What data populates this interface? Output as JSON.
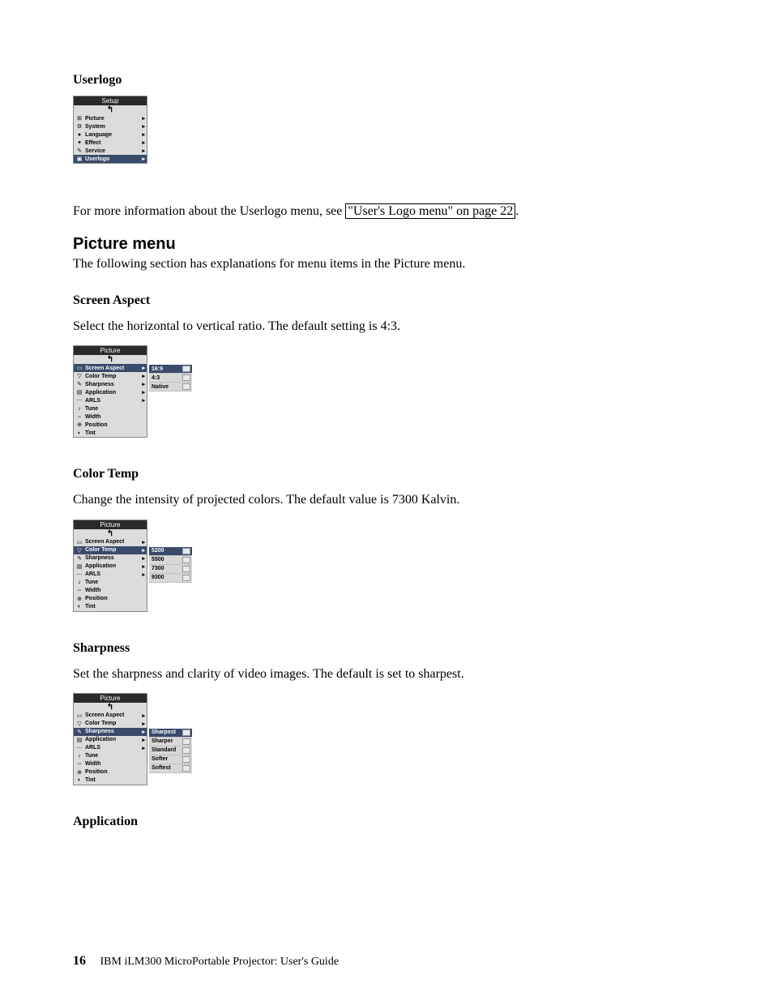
{
  "userlogo": {
    "heading": "Userlogo",
    "menu_title": "Setup",
    "items": [
      {
        "label": "Picture",
        "arrow": true,
        "icon": "⊞"
      },
      {
        "label": "System",
        "arrow": true,
        "icon": "⚙"
      },
      {
        "label": "Language",
        "arrow": true,
        "icon": "●"
      },
      {
        "label": "Effect",
        "arrow": true,
        "icon": "✦"
      },
      {
        "label": "Service",
        "arrow": true,
        "icon": "✎"
      },
      {
        "label": "Userlogo",
        "arrow": true,
        "icon": "▣",
        "selected": true
      }
    ],
    "para": "For more information about the Userlogo menu, see ",
    "link_text": "\"User's Logo menu\" on page 22",
    "para_end": "."
  },
  "picture_menu": {
    "heading": "Picture menu",
    "intro": "The following section has explanations for menu items in the Picture menu."
  },
  "screen_aspect": {
    "heading": "Screen Aspect",
    "para": "Select the horizontal to vertical ratio. The default setting is 4:3.",
    "menu_title": "Picture",
    "items": [
      {
        "label": "Screen Aspect",
        "arrow": true,
        "selected": true
      },
      {
        "label": "Color Temp",
        "arrow": true
      },
      {
        "label": "Sharpness",
        "arrow": true
      },
      {
        "label": "Application",
        "arrow": true
      },
      {
        "label": "ARLS",
        "arrow": true
      },
      {
        "label": "Tune"
      },
      {
        "label": "Width"
      },
      {
        "label": "Position"
      },
      {
        "label": "Tint"
      }
    ],
    "sub_items": [
      {
        "label": "16:9",
        "selected": true
      },
      {
        "label": "4:3"
      },
      {
        "label": "Native"
      }
    ]
  },
  "color_temp": {
    "heading": "Color Temp",
    "para": "Change the intensity of projected colors. The default value is 7300 Kalvin.",
    "menu_title": "Picture",
    "items": [
      {
        "label": "Screen Aspect",
        "arrow": true
      },
      {
        "label": "Color Temp",
        "arrow": true,
        "selected": true
      },
      {
        "label": "Sharpness",
        "arrow": true
      },
      {
        "label": "Application",
        "arrow": true
      },
      {
        "label": "ARLS",
        "arrow": true
      },
      {
        "label": "Tune"
      },
      {
        "label": "Width"
      },
      {
        "label": "Position"
      },
      {
        "label": "Tint"
      }
    ],
    "sub_items": [
      {
        "label": "5200",
        "selected": true
      },
      {
        "label": "5500"
      },
      {
        "label": "7300"
      },
      {
        "label": "9300"
      }
    ]
  },
  "sharpness": {
    "heading": "Sharpness",
    "para": "Set the sharpness and clarity of video images. The default is set to sharpest.",
    "menu_title": "Picture",
    "items": [
      {
        "label": "Screen Aspect",
        "arrow": true
      },
      {
        "label": "Color Temp",
        "arrow": true
      },
      {
        "label": "Sharpness",
        "arrow": true,
        "selected": true
      },
      {
        "label": "Application",
        "arrow": true
      },
      {
        "label": "ARLS",
        "arrow": true
      },
      {
        "label": "Tune"
      },
      {
        "label": "Width"
      },
      {
        "label": "Position"
      },
      {
        "label": "Tint"
      }
    ],
    "sub_items": [
      {
        "label": "Sharpest",
        "selected": true
      },
      {
        "label": "Sharper"
      },
      {
        "label": "Standard"
      },
      {
        "label": "Softer"
      },
      {
        "label": "Softest"
      }
    ]
  },
  "application": {
    "heading": "Application"
  },
  "footer": {
    "page": "16",
    "text": "IBM iLM300 MicroPortable Projector:  User's Guide"
  },
  "picture_icons": [
    "▭",
    "▽",
    "✎",
    "▤",
    "⋯",
    "♪",
    "⇔",
    "⊕",
    "◐"
  ]
}
